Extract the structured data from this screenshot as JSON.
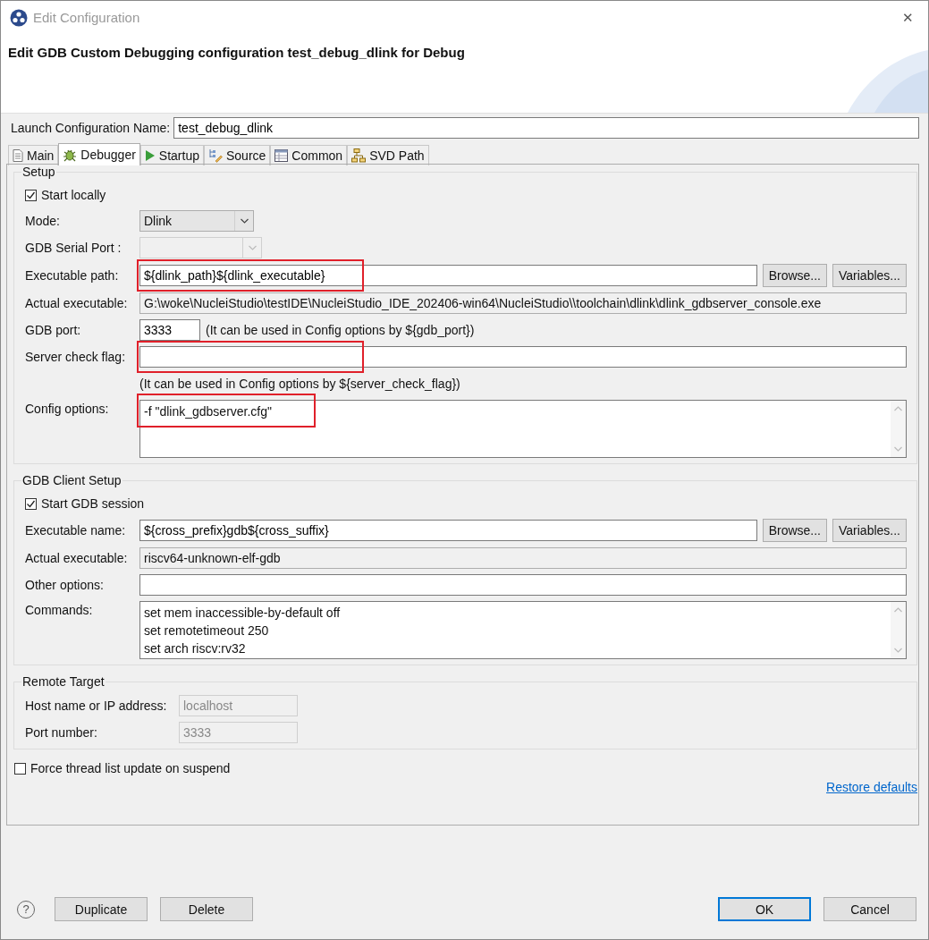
{
  "window": {
    "title": "Edit Configuration",
    "close": "✕"
  },
  "banner": {
    "title": "Edit GDB Custom Debugging configuration test_debug_dlink for Debug"
  },
  "launch_name": {
    "label": "Launch Configuration Name:",
    "value": "test_debug_dlink"
  },
  "tabs": [
    {
      "label": "Main",
      "selected": false
    },
    {
      "label": "Debugger",
      "selected": true
    },
    {
      "label": "Startup",
      "selected": false
    },
    {
      "label": "Source",
      "selected": false
    },
    {
      "label": "Common",
      "selected": false
    },
    {
      "label": "SVD Path",
      "selected": false
    }
  ],
  "groups": [
    {
      "title": "Setup",
      "rows": [
        {
          "kind": "checkbox",
          "label": "Start locally",
          "checked": true
        },
        {
          "kind": "combo",
          "label": "Mode:",
          "value": "Dlink",
          "disabled": false
        },
        {
          "kind": "combo",
          "label": "GDB Serial Port :",
          "disabled": true
        },
        {
          "kind": "text",
          "label": "Executable path:",
          "value": "${dlink_path}${dlink_executable}",
          "buttons": [
            "Browse...",
            "Variables..."
          ],
          "highlighted": true
        },
        {
          "kind": "readonly",
          "label": "Actual executable:",
          "value": "G:\\woke\\NucleiStudio\\testIDE\\NucleiStudio_IDE_202406-win64\\NucleiStudio\\\\toolchain\\dlink\\dlink_gdbserver_console.exe"
        },
        {
          "kind": "port",
          "label": "GDB port:",
          "value": "3333",
          "note": "(It can be used in Config options by ${gdb_port})"
        },
        {
          "kind": "text",
          "label": "Server check flag:",
          "highlighted": true
        },
        {
          "kind": "note",
          "text": "(It can be used in Config options by ${server_check_flag})"
        },
        {
          "kind": "textarea",
          "label": "Config options:",
          "lines": [
            "-f \"dlink_gdbserver.cfg\""
          ],
          "highlighted": true
        }
      ]
    },
    {
      "title": "GDB Client Setup",
      "rows": [
        {
          "kind": "checkbox",
          "label": "Start GDB session",
          "checked": true
        },
        {
          "kind": "text",
          "label": "Executable name:",
          "value": "${cross_prefix}gdb${cross_suffix}",
          "buttons": [
            "Browse...",
            "Variables..."
          ],
          "highlighted": false
        },
        {
          "kind": "readonly",
          "label": "Actual executable:",
          "value": "riscv64-unknown-elf-gdb"
        },
        {
          "kind": "text",
          "label": "Other options:",
          "highlighted": false
        },
        {
          "kind": "textarea",
          "label": "Commands:",
          "lines": [
            "set mem inaccessible-by-default off",
            "set remotetimeout 250",
            "set arch riscv:rv32"
          ],
          "highlighted": false
        }
      ]
    },
    {
      "title": "Remote Target",
      "rows": [
        {
          "kind": "short",
          "label": "Host name or IP address:",
          "value": "localhost",
          "disabled": true
        },
        {
          "kind": "short",
          "label": "Port number:",
          "value": "3333",
          "disabled": true
        }
      ]
    }
  ],
  "force_update": {
    "label": "Force thread list update on suspend",
    "checked": false
  },
  "restore_link": "Restore defaults",
  "footer": {
    "help": "?",
    "left_buttons": [
      {
        "label": "Duplicate",
        "default": false
      },
      {
        "label": "Delete",
        "default": false
      }
    ],
    "right_buttons": [
      {
        "label": "OK",
        "default": true
      },
      {
        "label": "Cancel",
        "default": false
      }
    ]
  }
}
